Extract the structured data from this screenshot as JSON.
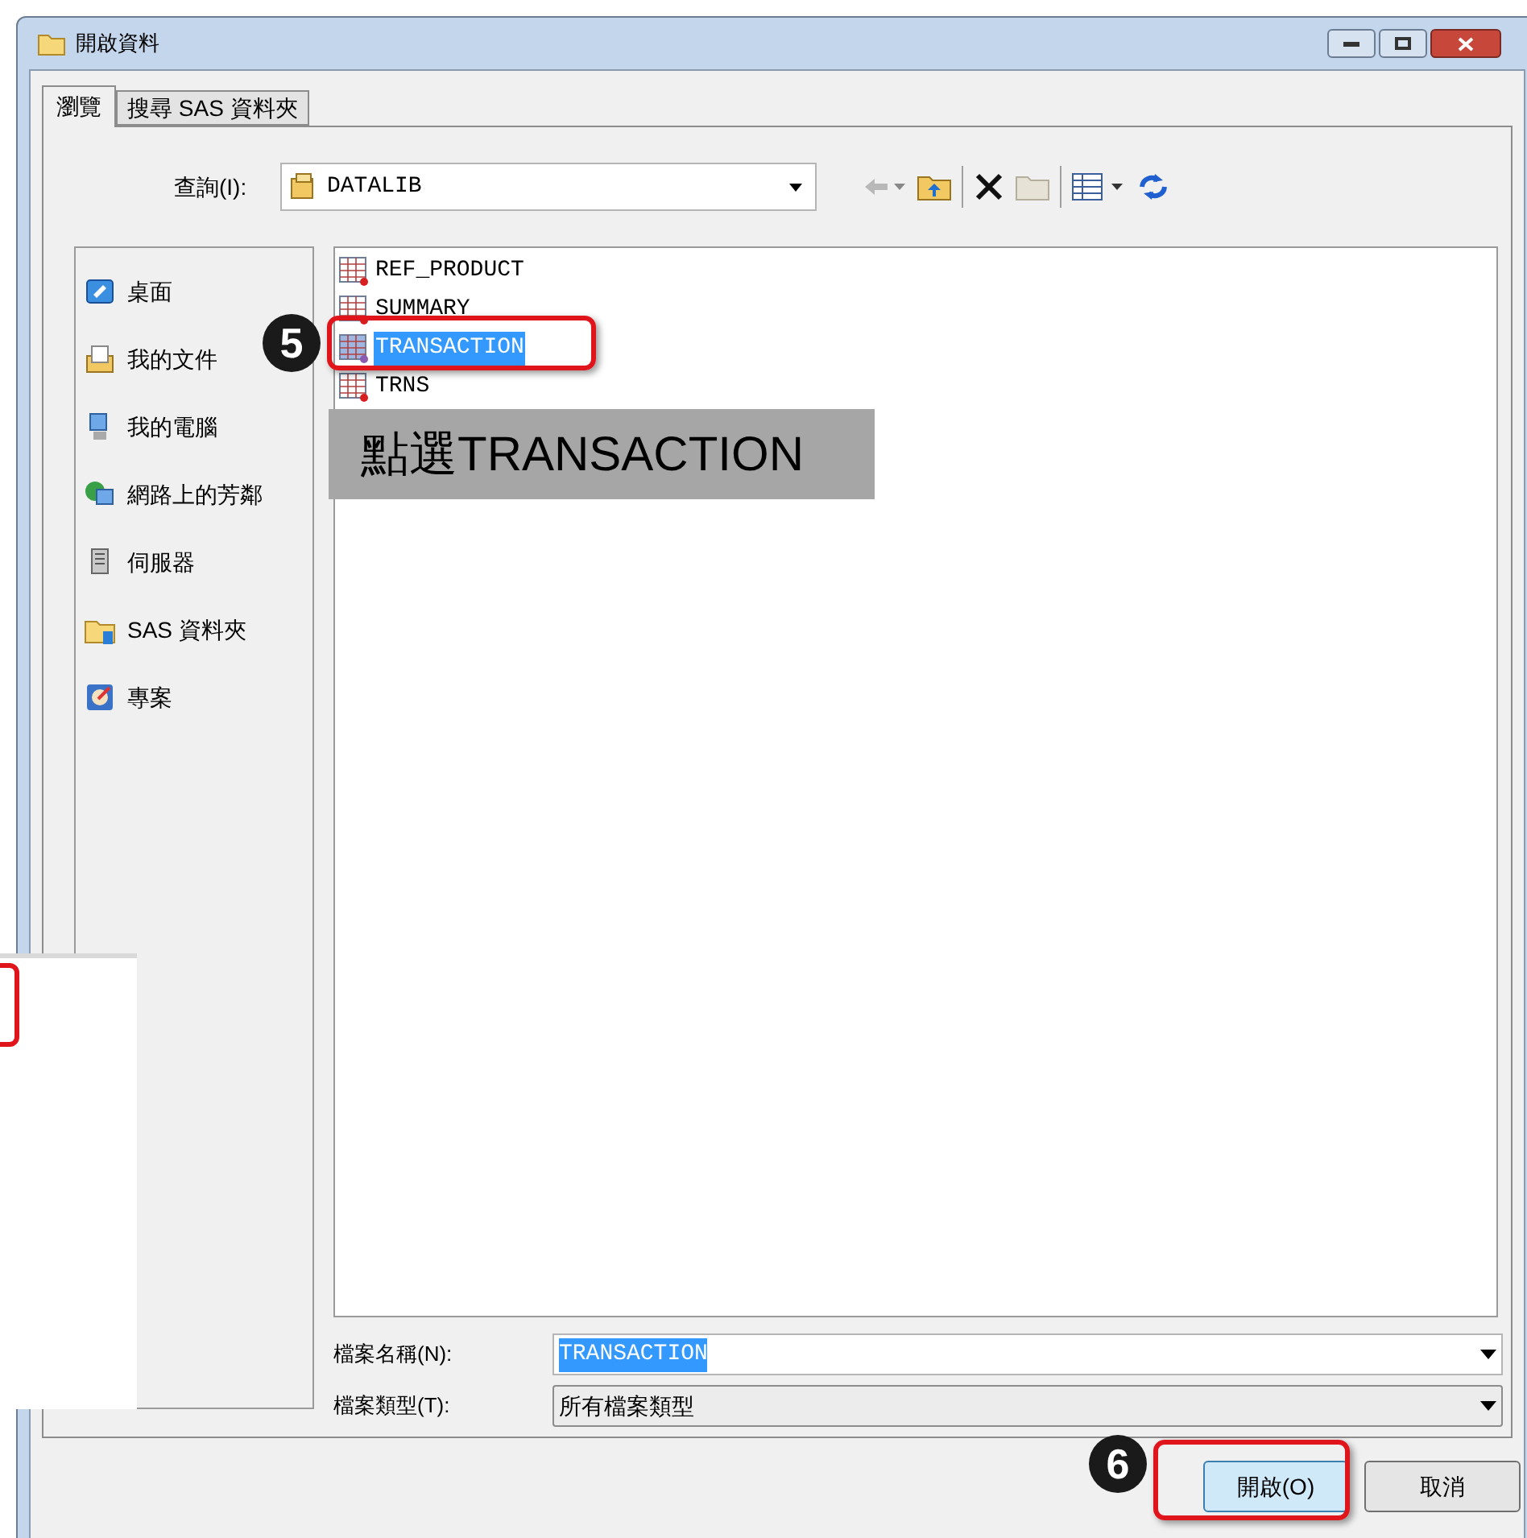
{
  "window": {
    "title": "開啟資料"
  },
  "tabs": [
    {
      "label": "瀏覽",
      "selected": true
    },
    {
      "label": "搜尋 SAS 資料夾",
      "selected": false
    }
  ],
  "look_in": {
    "label": "查詢(I):",
    "value": "DATALIB"
  },
  "places": [
    {
      "label": "桌面"
    },
    {
      "label": "我的文件"
    },
    {
      "label": "我的電腦"
    },
    {
      "label": "網路上的芳鄰"
    },
    {
      "label": "伺服器"
    },
    {
      "label": "SAS 資料夾"
    },
    {
      "label": "專案"
    }
  ],
  "files": [
    {
      "name": "REF_PRODUCT",
      "selected": false
    },
    {
      "name": "SUMMARY",
      "selected": false
    },
    {
      "name": "TRANSACTION",
      "selected": true
    },
    {
      "name": "TRNS",
      "selected": false
    }
  ],
  "file_name": {
    "label": "檔案名稱(N):",
    "value": "TRANSACTION"
  },
  "file_type": {
    "label": "檔案類型(T):",
    "value": "所有檔案類型"
  },
  "buttons": [
    {
      "label": "開啟(O)",
      "kind": "primary"
    },
    {
      "label": "取消",
      "kind": "normal"
    }
  ],
  "annotations": [
    {
      "step": "5",
      "note": "點選TRANSACTION"
    },
    {
      "step": "6"
    }
  ]
}
